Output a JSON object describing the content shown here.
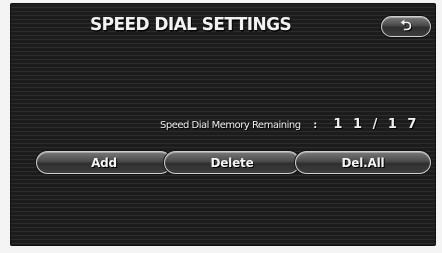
{
  "header": {
    "title": "SPEED DIAL SETTINGS",
    "back_icon": "return-arrow-icon",
    "back_symbol": "⮌"
  },
  "memory": {
    "label": "Speed Dial Memory Remaining",
    "separator": ":",
    "count": "1 1 / 1 7"
  },
  "actions": {
    "add": "Add",
    "delete": "Delete",
    "delete_all": "Del.All"
  },
  "colors": {
    "background": "#1c1c1c",
    "text": "#f2f2f2",
    "button_border": "#cfcfcf"
  }
}
